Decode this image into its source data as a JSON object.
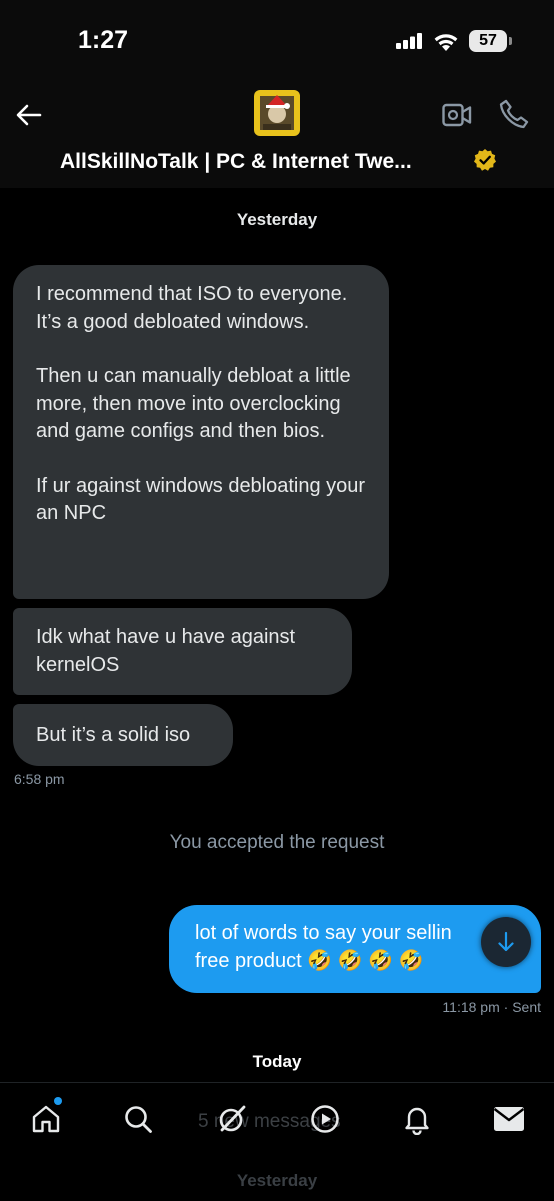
{
  "status_bar": {
    "time": "1:27",
    "battery": "57"
  },
  "header": {
    "contact_name": "AllSkillNoTalk | PC & Internet Twe..."
  },
  "conversation": {
    "day_yesterday": "Yesterday",
    "incoming": [
      {
        "paragraphs": [
          "I recommend that ISO to everyone. It’s a good debloated windows.",
          "Then u can manually debloat a little more, then move into overclocking and game configs and then bios.",
          "If ur against windows debloating your an NPC"
        ]
      },
      {
        "paragraphs": [
          "Idk what have u have against kernelOS"
        ]
      },
      {
        "paragraphs": [
          "But it’s a solid iso"
        ]
      }
    ],
    "incoming_time": "6:58 pm",
    "system_message": "You accepted the request",
    "outgoing": {
      "line1": "lot of words to say your sellin",
      "line2": "free product 🤣 🤣 🤣 🤣"
    },
    "outgoing_meta": "11:18 pm · Sent",
    "day_today": "Today"
  },
  "tabbar": {
    "new_messages": "5 new messages",
    "ghost_day": "Yesterday",
    "items": [
      "home",
      "search",
      "grok",
      "video",
      "notifications",
      "messages"
    ]
  },
  "colors": {
    "accent": "#1d9bf0",
    "incoming_bubble": "#2f3336",
    "verified": "#e2b719"
  }
}
